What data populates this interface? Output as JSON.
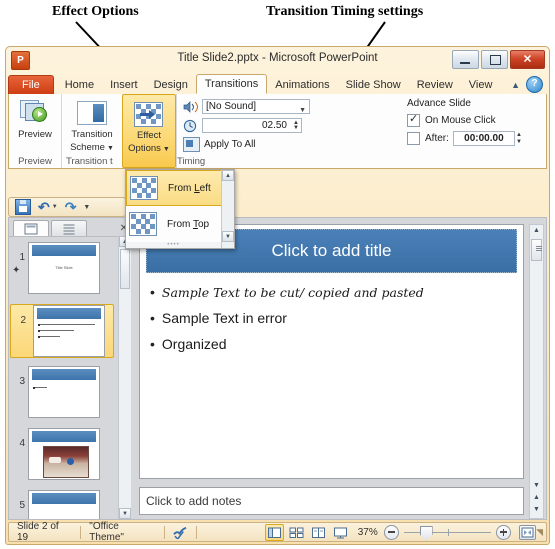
{
  "annotations": [
    {
      "id": "effect-options",
      "text": "Effect Options"
    },
    {
      "id": "transition-timing",
      "text": "Transition Timing settings"
    }
  ],
  "window": {
    "title": "Title Slide2.pptx  -  Microsoft PowerPoint",
    "logo_letter": "P",
    "controls": {
      "minimize": "minimize",
      "maximize": "maximize",
      "close": "✕"
    }
  },
  "ribbon": {
    "file_tab": "File",
    "tabs": [
      {
        "label": "Home",
        "active": false
      },
      {
        "label": "Insert",
        "active": false
      },
      {
        "label": "Design",
        "active": false
      },
      {
        "label": "Transitions",
        "active": true
      },
      {
        "label": "Animations",
        "active": false
      },
      {
        "label": "Slide Show",
        "active": false
      },
      {
        "label": "Review",
        "active": false
      },
      {
        "label": "View",
        "active": false
      }
    ],
    "help_label": "?",
    "groups": [
      {
        "name": "preview",
        "label": "Preview"
      },
      {
        "name": "transition-to-this-slide",
        "label": "Transition t"
      },
      {
        "name": "timing",
        "label": "Timing"
      }
    ],
    "preview_button": "Preview",
    "transition_scheme_button_line1": "Transition",
    "transition_scheme_button_line2": "Scheme",
    "effect_options_button_line1": "Effect",
    "effect_options_button_line2": "Options",
    "timing": {
      "sound_value": "[No Sound]",
      "duration_value": "02.50",
      "apply_to_all": "Apply To All",
      "advance_slide_label": "Advance Slide",
      "on_mouse_click_label": "On Mouse Click",
      "on_mouse_click_checked": true,
      "after_label": "After:",
      "after_value": "00:00.00",
      "after_checked": false
    }
  },
  "effect_dropdown": {
    "items": [
      {
        "label_pre": "From ",
        "label_key": "L",
        "label_post": "eft",
        "selected": true
      },
      {
        "label_pre": "From ",
        "label_key": "T",
        "label_post": "op",
        "selected": false
      }
    ]
  },
  "quick_access": {
    "items": [
      {
        "name": "save-icon"
      },
      {
        "name": "undo-icon"
      },
      {
        "name": "redo-icon"
      },
      {
        "name": "customize-qat-icon"
      }
    ]
  },
  "slides_panel": {
    "tabs": [
      {
        "name": "slides-tab",
        "active": true
      },
      {
        "name": "outline-tab",
        "active": false
      }
    ],
    "close_label": "✕",
    "thumbnails": [
      {
        "number": "1",
        "selected": false,
        "kind": "title",
        "center_text": "Title Slide"
      },
      {
        "number": "2",
        "selected": true,
        "kind": "bullets",
        "has_transition_star": true
      },
      {
        "number": "3",
        "selected": false,
        "kind": "short"
      },
      {
        "number": "4",
        "selected": false,
        "kind": "image"
      },
      {
        "number": "5",
        "selected": false,
        "kind": "partial"
      }
    ]
  },
  "slide": {
    "title_placeholder": "Click to add title",
    "bullets": [
      {
        "text": "Sample Text to be cut/ copied and pasted",
        "style": "script"
      },
      {
        "text": "Sample Text in error",
        "style": "normal"
      },
      {
        "text": "Organized",
        "style": "normal"
      }
    ]
  },
  "notes": {
    "placeholder": "Click to add notes"
  },
  "status_bar": {
    "slide_counter": "Slide 2 of 19",
    "theme": "\"Office Theme\"",
    "spell_check_icon": "spell-check-icon",
    "views": [
      {
        "name": "normal-view",
        "active": true
      },
      {
        "name": "slide-sorter-view",
        "active": false
      },
      {
        "name": "reading-view",
        "active": false
      },
      {
        "name": "slide-show-view",
        "active": false
      }
    ],
    "zoom_percent": "37%",
    "fit_button": "fit-slide-to-window"
  },
  "colors": {
    "accent_orange": "#cf3d12",
    "highlight_yellow": "#fbd777",
    "slide_blue": "#3d75ab",
    "chrome": "#f7dfae"
  }
}
